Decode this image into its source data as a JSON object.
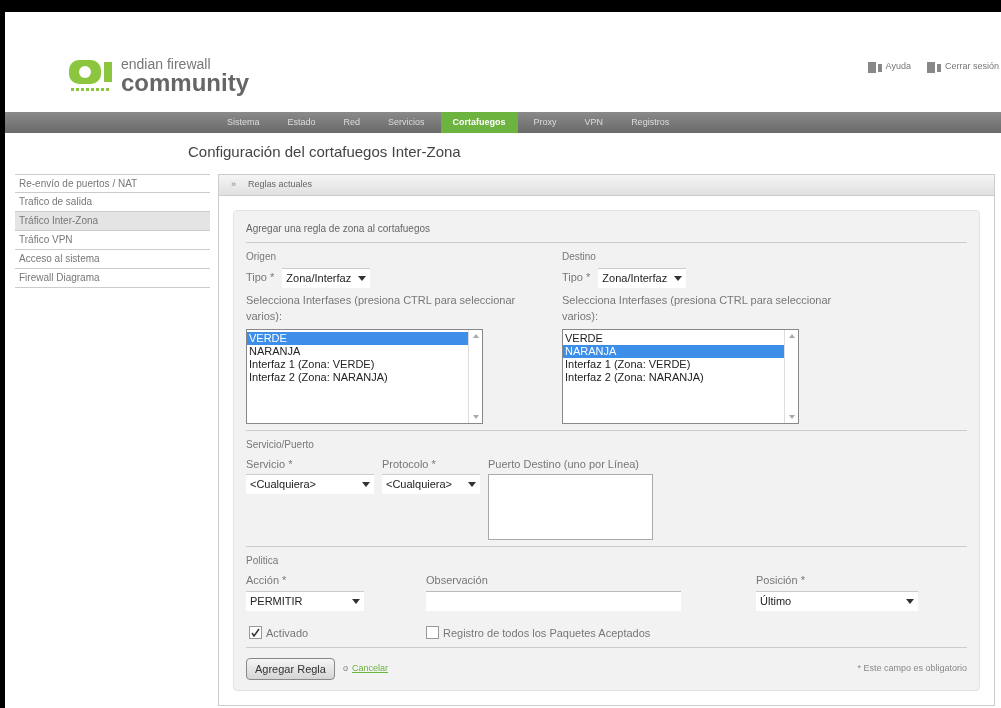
{
  "logo": {
    "line1": "endian firewall",
    "line2": "community"
  },
  "top_links": [
    {
      "label": "Ayuda"
    },
    {
      "label": "Cerrar sesión"
    }
  ],
  "nav": [
    {
      "label": "Sistema",
      "selected": false
    },
    {
      "label": "Estado",
      "selected": false
    },
    {
      "label": "Red",
      "selected": false
    },
    {
      "label": "Servicios",
      "selected": false
    },
    {
      "label": "Cortafuegos",
      "selected": true
    },
    {
      "label": "Proxy",
      "selected": false
    },
    {
      "label": "VPN",
      "selected": false
    },
    {
      "label": "Registros",
      "selected": false
    }
  ],
  "page_title": "Configuración del cortafuegos Inter-Zona",
  "sidebar": [
    {
      "label": "Re-envío de puertos / NAT",
      "selected": false
    },
    {
      "label": "Trafico de salida",
      "selected": false
    },
    {
      "label": "Tráfico Inter-Zona",
      "selected": true
    },
    {
      "label": "Tráfico VPN",
      "selected": false
    },
    {
      "label": "Acceso al sistema",
      "selected": false
    },
    {
      "label": "Firewall Diagrama",
      "selected": false
    }
  ],
  "section_toggle": {
    "icon": "»",
    "label": "Reglas actuales"
  },
  "form": {
    "title": "Agregar una regla de zona al cortafuegos",
    "origin": {
      "heading": "Origen",
      "type_label": "Tipo *",
      "type_value": "Zona/Interfaz",
      "list_label": "Selecciona Interfases (presiona CTRL para seleccionar varios):",
      "options": [
        {
          "label": "VERDE",
          "selected": true
        },
        {
          "label": "NARANJA",
          "selected": false
        },
        {
          "label": "Interfaz 1 (Zona: VERDE)",
          "selected": false
        },
        {
          "label": "Interfaz 2 (Zona: NARANJA)",
          "selected": false
        }
      ]
    },
    "destination": {
      "heading": "Destino",
      "type_label": "Tipo *",
      "type_value": "Zona/Interfaz",
      "list_label": "Selecciona Interfases (presiona CTRL para seleccionar varios):",
      "options": [
        {
          "label": "VERDE",
          "selected": false
        },
        {
          "label": "NARANJA",
          "selected": true
        },
        {
          "label": "Interfaz 1 (Zona: VERDE)",
          "selected": false
        },
        {
          "label": "Interfaz 2 (Zona: NARANJA)",
          "selected": false
        }
      ]
    },
    "service": {
      "heading": "Servicio/Puerto",
      "service_label": "Servicio *",
      "service_value": "<Cualquiera>",
      "protocol_label": "Protocolo *",
      "protocol_value": "<Cualquiera>",
      "port_label": "Puerto Destino (uno por Línea)"
    },
    "policy": {
      "heading": "Politica",
      "action_label": "Acción *",
      "action_value": "PERMITIR",
      "note_label": "Observación",
      "position_label": "Posición *",
      "position_value": "Último",
      "enabled": {
        "label": "Activado",
        "checked": true
      },
      "log": {
        "label": "Registro de todos los Paquetes Aceptados",
        "checked": false
      }
    },
    "submit": "Agregar Regla",
    "or": "o",
    "cancel": "Cancelar",
    "required_note": "* Este campo es obligatorio"
  }
}
